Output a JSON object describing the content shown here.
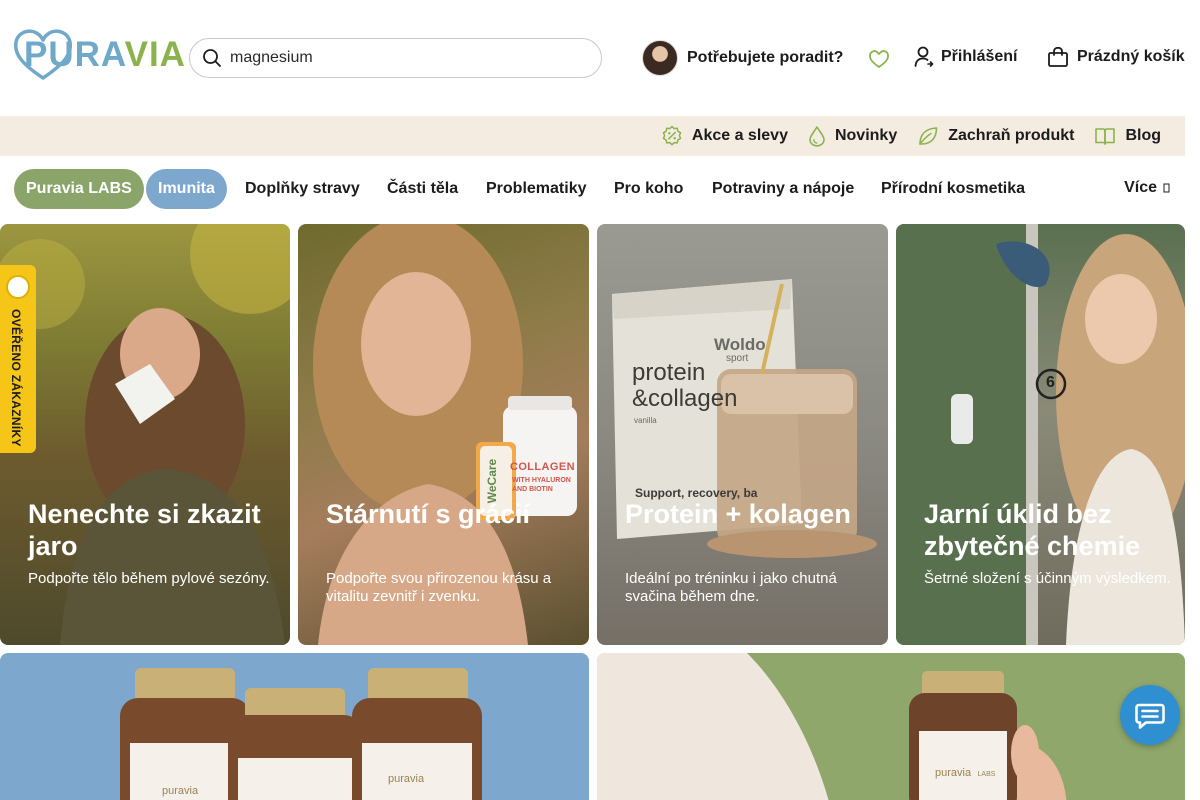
{
  "header": {
    "logo": {
      "text_pu": "PU",
      "text_ra": "RA",
      "text_via": "VIA"
    },
    "search": {
      "value": "magnesium",
      "placeholder": "magnesium"
    },
    "advice_label": "Potřebujete poradit?",
    "login_label": "Přihlášení",
    "cart_label": "Prázdný košík"
  },
  "promo_strip": {
    "items": [
      {
        "label": "Akce a slevy",
        "icon": "discount-icon"
      },
      {
        "label": "Novinky",
        "icon": "drop-icon"
      },
      {
        "label": "Zachraň produkt",
        "icon": "leaf-icon"
      },
      {
        "label": "Blog",
        "icon": "book-icon"
      }
    ],
    "background": "#f4ebe1"
  },
  "categories": {
    "items": [
      {
        "label": "Puravia LABS"
      },
      {
        "label": "Imunita"
      },
      {
        "label": "Doplňky stravy"
      },
      {
        "label": "Části těla"
      },
      {
        "label": "Problematiky"
      },
      {
        "label": "Pro koho"
      },
      {
        "label": "Potraviny a nápoje"
      },
      {
        "label": "Přírodní kosmetika"
      }
    ],
    "more_label": "Více",
    "pill_colors": {
      "labs": "#8aa46a",
      "imunita": "#7ea7cd"
    }
  },
  "banners": [
    {
      "title": "Nenechte si zkazit jaro",
      "subtitle": "Podpořte tělo během pylové sezóny."
    },
    {
      "title": "Stárnutí s grácií",
      "subtitle": "Podpořte svou přirozenou krásu a vitalitu zevnitř i zvenku.",
      "product_label": "COLLAGEN",
      "product_sub": "WITH HYALURON AND BIOTIN",
      "brand": "WeCare"
    },
    {
      "title": "Protein + kolagen",
      "subtitle": "Ideální po tréninku i jako chutná svačina během dne.",
      "product_brand": "Woldo",
      "product_brand_sub": "sport",
      "product_name": "protein &collagen",
      "product_flavor": "vanilla",
      "product_claim": "Support, recovery, ba"
    },
    {
      "title": "Jarní úklid bez zbytečné chemie",
      "subtitle": "Šetrné složení s účinným výsledkem.",
      "window_number": "6"
    }
  ],
  "bottom_banners": [
    {
      "product_brand": "puravia",
      "colors": "#7ea7cd"
    },
    {
      "product_brand": "puravia",
      "product_brand_sub": "LABS",
      "colors": "#8fa76a"
    }
  ],
  "verified_badge": {
    "label": "OVĚŘENO ZÁKAZNÍKY"
  },
  "chat": {
    "icon": "chat-icon"
  }
}
